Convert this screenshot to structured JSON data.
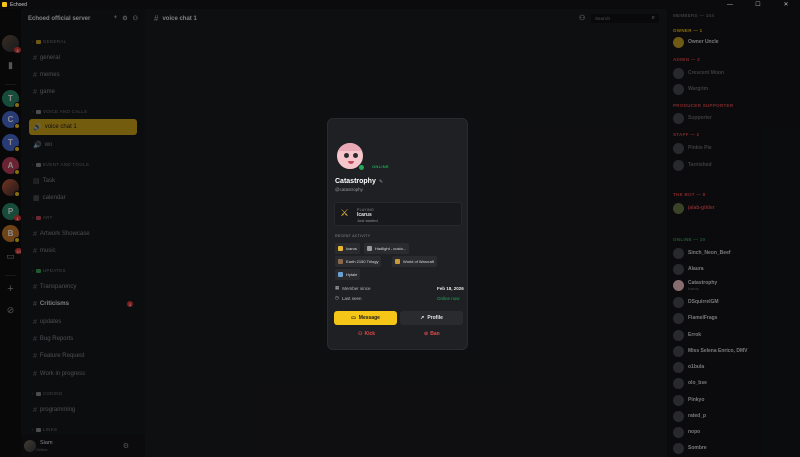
{
  "window": {
    "title": "Echoed",
    "controls": [
      "—",
      "☐",
      "✕"
    ]
  },
  "servers": [
    {
      "letter": "T",
      "color": "#2c8a6a",
      "badge": ""
    },
    {
      "letter": "C",
      "color": "#4a6cd4",
      "badge": ""
    },
    {
      "letter": "T",
      "color": "#4a6cd4",
      "badge": ""
    },
    {
      "letter": "A",
      "color": "#c0405c",
      "badge": ""
    },
    {
      "letter": "P",
      "color": "#2c8a6a",
      "badge": "1"
    },
    {
      "letter": "B",
      "color": "#c97b2c",
      "badge": ""
    }
  ],
  "rail_badges": {
    "top": "3",
    "inbox": "10"
  },
  "sidebar": {
    "server_name": "Echoed official server",
    "categories": {
      "general": "GENERAL",
      "voice": "VOICE AND CALLS",
      "events": "EVENT AND TOOLS",
      "art": "ART",
      "updates": "UPDATES",
      "coding": "CODING",
      "misc": "LINKS"
    },
    "channels": {
      "general": "general",
      "memes": "memes",
      "game": "game",
      "voice_chat_1": "voice chat 1",
      "wo": "wo",
      "task": "Task",
      "calendar": "calendar",
      "artwork": "Artwork Showcase",
      "music": "music",
      "transparency": "Transparency",
      "criticisms": "Criticisms",
      "updates": "updates",
      "bug_reports": "Bug Reports",
      "feature_request": "Feature Request",
      "work_in_progress": "Work in progress",
      "programming": "programming"
    },
    "criticisms_unread": "1",
    "user": {
      "name": "Siam",
      "status": "Online"
    }
  },
  "main": {
    "channel_title": "voice chat 1",
    "search_placeholder": "Search"
  },
  "members": {
    "header": "MEMBERS — 104",
    "groups": {
      "owner": "OWNER — 1",
      "admin": "ADMIN — 3",
      "prod": "PRODUCER SUPPORTER",
      "staff": "STAFF — 2",
      "bot": "THE BOT — 8",
      "online": "ONLINE — 10"
    },
    "list": [
      {
        "name": "Owner Uncle",
        "sub": ""
      },
      {
        "name": "Crescent Moon",
        "sub": ""
      },
      {
        "name": "Wargrim",
        "sub": ""
      },
      {
        "name": "Supporter",
        "sub": ""
      },
      {
        "name": "Pinkie Pie",
        "sub": ""
      },
      {
        "name": "Tarnished",
        "sub": ""
      },
      {
        "name": "jalab-gilder",
        "sub": ""
      },
      {
        "name": "Sinch_Neon_Beef",
        "sub": ""
      },
      {
        "name": "Alaura",
        "sub": ""
      },
      {
        "name": "Catastrophy",
        "sub": "Icarus"
      },
      {
        "name": "DSquirrelGM",
        "sub": ""
      },
      {
        "name": "FlamelFrags",
        "sub": ""
      },
      {
        "name": "Errok",
        "sub": ""
      },
      {
        "name": "Miss Selena Enrico, DMV",
        "sub": ""
      },
      {
        "name": "o1bula",
        "sub": ""
      },
      {
        "name": "olo_bse",
        "sub": ""
      },
      {
        "name": "Pinkyo",
        "sub": ""
      },
      {
        "name": "rated_p",
        "sub": ""
      },
      {
        "name": "nopo",
        "sub": ""
      },
      {
        "name": "Sombre",
        "sub": ""
      }
    ]
  },
  "profile": {
    "status": "ONLINE",
    "display_name": "Catastrophy",
    "handle": "@catastrophy",
    "playing_label": "PLAYING",
    "game": "Icarus",
    "game_time": "Just started",
    "recent_label": "RECENT ACTIVITY",
    "recent": [
      "Icarus",
      "Hadlight - custo...",
      "Earth 2150 Trilogy",
      "World of Warcraft",
      "Hytale"
    ],
    "member_since_label": "Member since",
    "member_since": "Feb 18, 2026",
    "last_seen_label": "Last seen",
    "last_seen": "Online now",
    "message_btn": "Message",
    "profile_btn": "Profile",
    "kick": "Kick",
    "ban": "Ban"
  },
  "colors": {
    "accent": "#f5c518",
    "online": "#23a55a",
    "danger": "#e14b4b"
  }
}
